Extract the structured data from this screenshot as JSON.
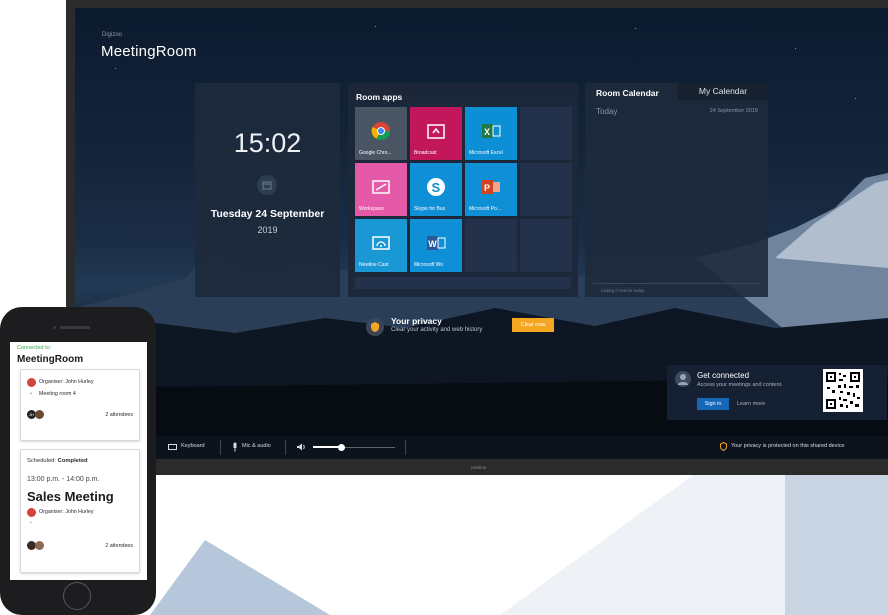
{
  "tv": {
    "brand_small": "Digizoo",
    "brand": "MeetingRoom",
    "footer_label": "newline"
  },
  "clock": {
    "time": "15:02",
    "date": "Tuesday 24 September",
    "year": "2019"
  },
  "room_apps": {
    "title": "Room apps",
    "apps": [
      {
        "label": "Google Chro...",
        "color": "#4a5564",
        "icon": "chrome-icon"
      },
      {
        "label": "Broadcast",
        "color": "#c2185b",
        "icon": "broadcast-icon"
      },
      {
        "label": "Microsoft Excel",
        "color": "#0d8fd6",
        "icon": "excel-icon"
      },
      {
        "label": "Workspace",
        "color": "#e45aa8",
        "icon": "workspace-icon"
      },
      {
        "label": "Skype for Bus",
        "color": "#0f8fd6",
        "icon": "skype-icon"
      },
      {
        "label": "Microsoft Po...",
        "color": "#0f8fd6",
        "icon": "powerpoint-icon"
      },
      {
        "label": "Newline Cast",
        "color": "#1a97d5",
        "icon": "cast-icon"
      },
      {
        "label": "Microsoft Wo",
        "color": "#0f8fd6",
        "icon": "word-icon"
      }
    ]
  },
  "calendar": {
    "tab_room": "Room Calendar",
    "tab_my": "My Calendar",
    "today": "Today",
    "date": "24 September 2019",
    "list_label": "Listing 0 events today"
  },
  "privacy": {
    "title": "Your privacy",
    "subtitle": "Clear your activity and web history",
    "button": "Clear now"
  },
  "connect": {
    "title": "Get connected",
    "subtitle": "Access your meetings and content.",
    "signin": "Sign in",
    "learn": "Learn more"
  },
  "taskbar": {
    "keyboard": "Keyboard",
    "mic": "Mic & audio",
    "privacy_note": "Your privacy is protected on this shared device",
    "volume": 0.35
  },
  "phone": {
    "connected_label": "Connected to:",
    "room": "MeetingRoom",
    "card1": {
      "organiser_label": "Organiser:",
      "organiser": "John Hurley",
      "room": "Meeting room 4",
      "attendees": "2 attendees",
      "avatar_initials": "JH"
    },
    "card2": {
      "scheduled_label": "Scheduled:",
      "scheduled_status": "Completed",
      "time": "13:00 p.m. - 14:00 p.m.",
      "title": "Sales Meeting",
      "organiser_label": "Organiser:",
      "organiser": "John Hurley",
      "attendees": "2 attendees"
    }
  }
}
